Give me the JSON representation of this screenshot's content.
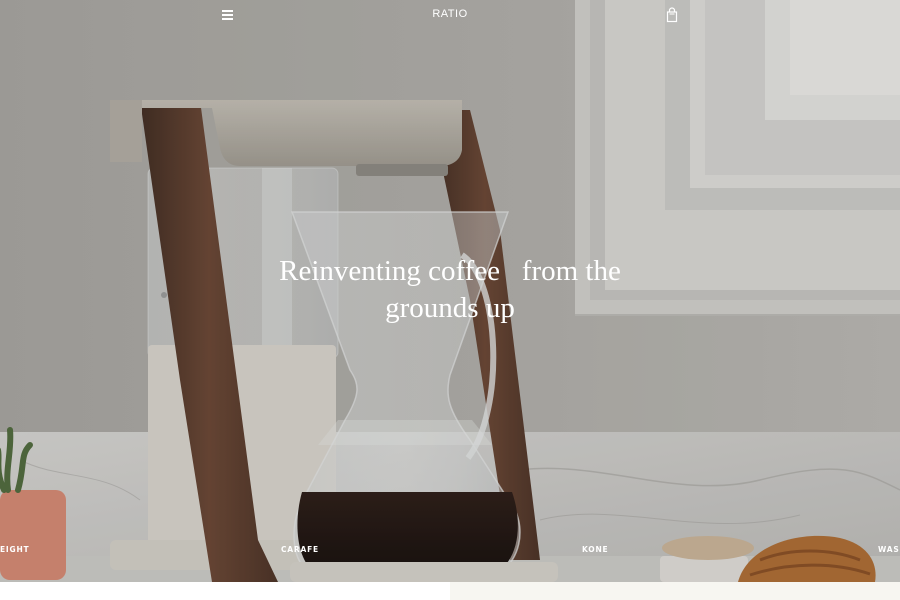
{
  "header": {
    "brand": "RATIO",
    "menu_icon": "hamburger-icon",
    "cart_icon": "shopping-bag-icon"
  },
  "hero": {
    "headline_line1": "Reinventing coffee   from the",
    "headline_line2": "grounds up"
  },
  "categories": [
    {
      "label": "EIGHT"
    },
    {
      "label": "CARAFE"
    },
    {
      "label": "KONE"
    },
    {
      "label": "WASH"
    }
  ],
  "colors": {
    "wall": "#aaa8a3",
    "walnut": "#5b3b2a",
    "brushed_metal": "#b0aba2",
    "text_overlay": "#ffffff",
    "bottom_strip_right": "#f7f6f1"
  }
}
